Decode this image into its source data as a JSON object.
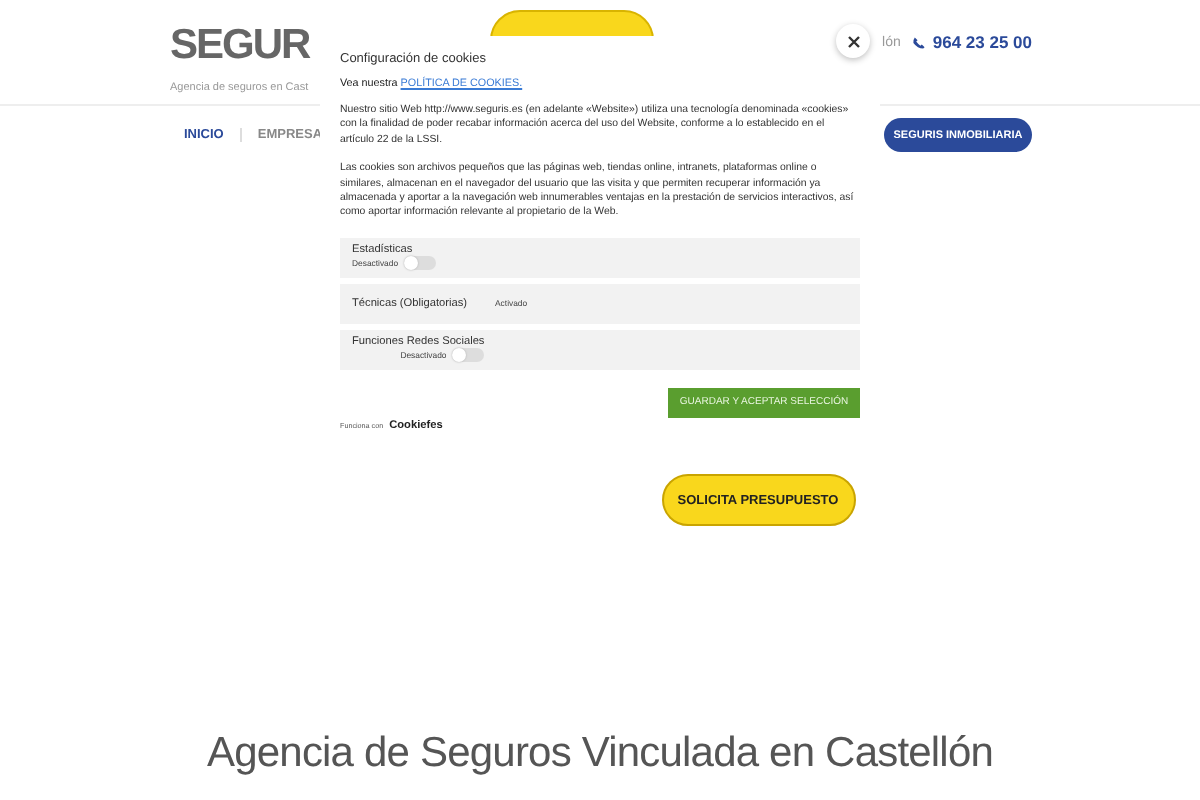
{
  "header": {
    "logo": "SEGUR",
    "tagline": "Agencia de seguros en Cast",
    "location_fragment": "lón",
    "phone": "964 23 25 00"
  },
  "nav": {
    "items": [
      {
        "label": "INICIO",
        "selected": true
      },
      {
        "label": "EMPRESA",
        "selected": false
      }
    ],
    "cta": "SEGURIS INMOBILIARIA"
  },
  "hero": {
    "cta": "SOLICITA PRESUPUESTO",
    "heading": "Agencia de Seguros Vinculada en Castellón"
  },
  "cookie_dialog": {
    "title": "Configuración de cookies",
    "policy_prefix": "Vea nuestra",
    "policy_link": "POLÍTICA DE COOKIES.",
    "paragraphs": [
      "Nuestro sitio Web http://www.seguris.es (en adelante «Website») utiliza una tecnología denominada «cookies» con la finalidad de poder recabar información acerca del uso del Website, conforme a lo establecido en el artículo 22 de la LSSI.",
      "Las cookies son archivos pequeños que las páginas web, tiendas online, intranets, plataformas online o similares, almacenan en el navegador del usuario que las visita y que permiten recuperar información ya almacenada y aportar a la navegación web innumerables ventajas en la prestación de servicios interactivos, así como aportar información relevante al propietario de la Web."
    ],
    "categories": [
      {
        "name": "Estadísticas",
        "kind": "toggle",
        "status": "Desactivado",
        "on": false
      },
      {
        "name": "Técnicas (Obligatorias)",
        "kind": "fixed",
        "status": "Activado"
      },
      {
        "name": "Funciones Redes Sociales",
        "kind": "toggle",
        "status": "Desactivado",
        "on": false
      }
    ],
    "save_button": "GUARDAR Y ACEPTAR SELECCIÓN",
    "powered_prefix": "Funciona con",
    "powered_brand": "Cookiefes"
  }
}
